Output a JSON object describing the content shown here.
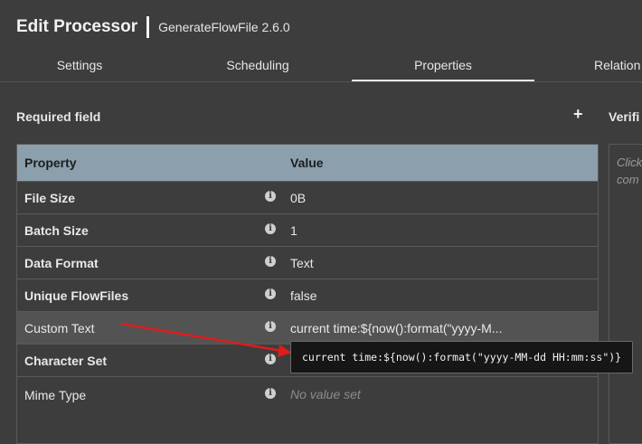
{
  "header": {
    "title": "Edit Processor",
    "subtitle": "GenerateFlowFile 2.6.0"
  },
  "tabs": [
    {
      "label": "Settings",
      "active": false
    },
    {
      "label": "Scheduling",
      "active": false
    },
    {
      "label": "Properties",
      "active": true
    },
    {
      "label": "Relation",
      "active": false
    }
  ],
  "section": {
    "required_label": "Required field",
    "add_icon": "plus-icon"
  },
  "verify": {
    "title": "Verifi",
    "hint": "Click\ncom"
  },
  "table": {
    "headers": {
      "property": "Property",
      "value": "Value"
    },
    "rows": [
      {
        "name": "File Size",
        "bold": true,
        "value": "0B"
      },
      {
        "name": "Batch Size",
        "bold": true,
        "value": "1"
      },
      {
        "name": "Data Format",
        "bold": true,
        "value": "Text"
      },
      {
        "name": "Unique FlowFiles",
        "bold": true,
        "value": "false"
      },
      {
        "name": "Custom Text",
        "bold": false,
        "value": "current time:${now():format(\"yyyy-M..."
      },
      {
        "name": "Character Set",
        "bold": true,
        "value": ""
      },
      {
        "name": "Mime Type",
        "bold": false,
        "value": "No value set"
      }
    ]
  },
  "tooltip": {
    "text": "current time:${now():format(\"yyyy-MM-dd HH:mm:ss\")}"
  },
  "colors": {
    "header_row": "#8ba0ac",
    "background": "#3d3d3d",
    "annotation_arrow": "#e01b1b"
  }
}
